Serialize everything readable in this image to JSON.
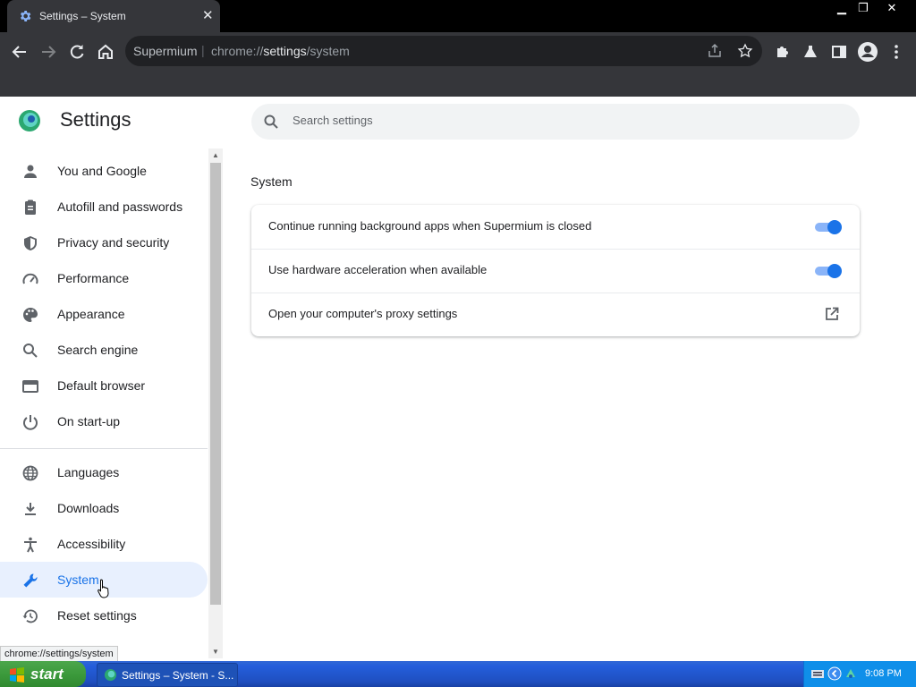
{
  "browser": {
    "tab_title": "Settings – System",
    "omnibox_site": "Supermium",
    "omnibox_separator": "|",
    "url_scheme": "chrome://",
    "url_host": "settings",
    "url_path": "/system"
  },
  "page": {
    "title": "Settings",
    "search_placeholder": "Search settings",
    "section_title": "System"
  },
  "sidebar": {
    "items": [
      {
        "label": "You and Google",
        "icon": "person-icon"
      },
      {
        "label": "Autofill and passwords",
        "icon": "clipboard-icon"
      },
      {
        "label": "Privacy and security",
        "icon": "shield-icon"
      },
      {
        "label": "Performance",
        "icon": "speedometer-icon"
      },
      {
        "label": "Appearance",
        "icon": "palette-icon"
      },
      {
        "label": "Search engine",
        "icon": "search-icon"
      },
      {
        "label": "Default browser",
        "icon": "browser-window-icon"
      },
      {
        "label": "On start-up",
        "icon": "power-icon"
      },
      {
        "label": "Languages",
        "icon": "globe-icon"
      },
      {
        "label": "Downloads",
        "icon": "download-icon"
      },
      {
        "label": "Accessibility",
        "icon": "accessibility-icon"
      },
      {
        "label": "System",
        "icon": "wrench-icon",
        "active": true
      },
      {
        "label": "Reset settings",
        "icon": "history-icon"
      }
    ]
  },
  "system_settings": [
    {
      "label": "Continue running background apps when Supermium is closed",
      "control": "toggle",
      "enabled": true
    },
    {
      "label": "Use hardware acceleration when available",
      "control": "toggle",
      "enabled": true
    },
    {
      "label": "Open your computer's proxy settings",
      "control": "external-link"
    }
  ],
  "statusbar": {
    "text": "chrome://settings/system"
  },
  "taskbar": {
    "start_label": "start",
    "task_label": "Settings – System - S...",
    "clock": "9:08 PM"
  },
  "colors": {
    "accent": "#1a73e8",
    "toolbar": "#35363a",
    "active_nav_bg": "#e8f0fe"
  }
}
